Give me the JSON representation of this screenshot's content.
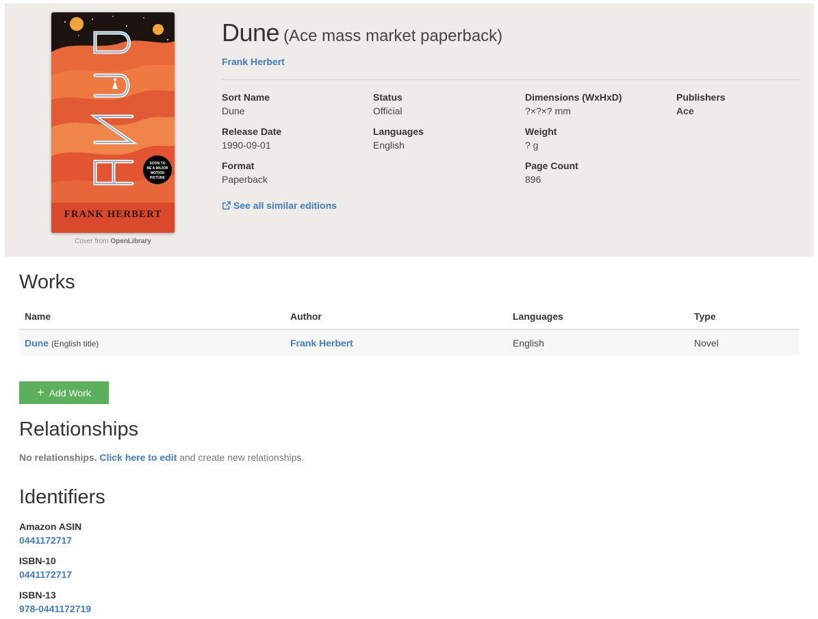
{
  "edition": {
    "title": "Dune",
    "subtitle": "(Ace mass market paperback)",
    "author": "Frank Herbert",
    "cover_credit_prefix": "Cover from",
    "cover_credit_source": "OpenLibrary",
    "cover": {
      "title_text": "DUNE",
      "author_text": "FRANK HERBERT",
      "badge_lines": [
        "SOON TO",
        "BE A MAJOR",
        "MOTION",
        "PICTURE"
      ]
    }
  },
  "properties": {
    "sort_name": {
      "label": "Sort Name",
      "value": "Dune"
    },
    "status": {
      "label": "Status",
      "value": "Official"
    },
    "dimensions": {
      "label": "Dimensions (WxHxD)",
      "value": "?×?×? mm"
    },
    "publishers": {
      "label": "Publishers",
      "value": "Ace"
    },
    "release_date": {
      "label": "Release Date",
      "value": "1990-09-01"
    },
    "languages": {
      "label": "Languages",
      "value": "English"
    },
    "weight": {
      "label": "Weight",
      "value": "? g"
    },
    "format": {
      "label": "Format",
      "value": "Paperback"
    },
    "page_count": {
      "label": "Page Count",
      "value": "896"
    }
  },
  "similar_link": "See all similar editions",
  "works": {
    "heading": "Works",
    "columns": [
      "Name",
      "Author",
      "Languages",
      "Type"
    ],
    "rows": [
      {
        "name": "Dune",
        "name_note": "(English title)",
        "author": "Frank Herbert",
        "languages": "English",
        "type": "Novel"
      }
    ],
    "add_button": "Add Work"
  },
  "relationships": {
    "heading": "Relationships",
    "empty_prefix": "No relationships.",
    "edit_link": "Click here to edit",
    "empty_suffix": "and create new relationships."
  },
  "identifiers": {
    "heading": "Identifiers",
    "items": [
      {
        "label": "Amazon ASIN",
        "value": "0441172717"
      },
      {
        "label": "ISBN-10",
        "value": "0441172717"
      },
      {
        "label": "ISBN-13",
        "value": "978-0441172719"
      }
    ]
  },
  "colors": {
    "link": "#3f7dc4",
    "hero_bg": "#efebe9",
    "add_button": "#5cb05c"
  },
  "icons": {
    "similar": "external-link-icon",
    "add": "plus-icon"
  }
}
